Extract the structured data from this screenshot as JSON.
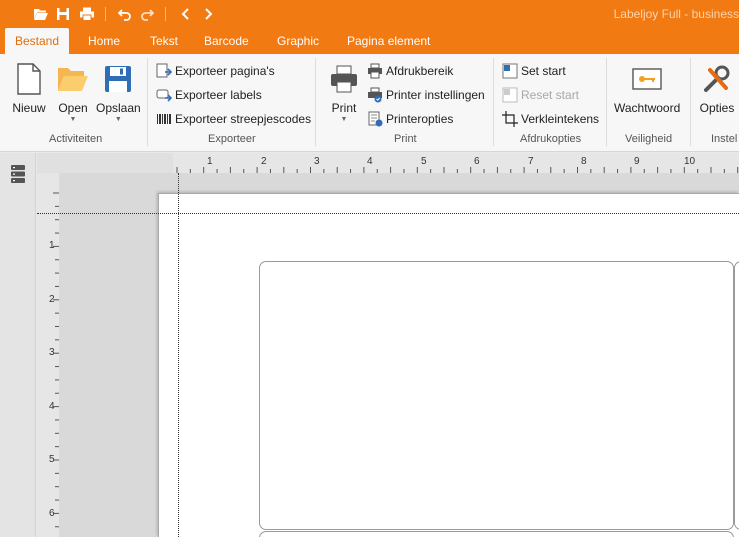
{
  "app": {
    "title": "Labeljoy Full - business",
    "accent": "#f27a12"
  },
  "quick_access": [
    {
      "name": "open-icon"
    },
    {
      "name": "save-icon"
    },
    {
      "name": "print-icon"
    },
    {
      "name": "undo-icon"
    },
    {
      "name": "redo-icon"
    },
    {
      "name": "back-icon"
    },
    {
      "name": "forward-icon"
    }
  ],
  "tabs": [
    {
      "label": "Bestand",
      "active": true
    },
    {
      "label": "Home"
    },
    {
      "label": "Tekst"
    },
    {
      "label": "Barcode"
    },
    {
      "label": "Graphic"
    },
    {
      "label": "Pagina element"
    }
  ],
  "ribbon": {
    "activiteiten": {
      "label": "Activiteiten",
      "nieuw": "Nieuw",
      "open": "Open",
      "opslaan": "Opslaan"
    },
    "exporteer": {
      "label": "Exporteer",
      "paginas": "Exporteer pagina's",
      "labels": "Exporteer labels",
      "streepjescodes": "Exporteer streepjescodes"
    },
    "print": {
      "label": "Print",
      "print": "Print",
      "afdrukbereik": "Afdrukbereik",
      "printer_instellingen": "Printer instellingen",
      "printeropties": "Printeropties"
    },
    "afdrukopties": {
      "label": "Afdrukopties",
      "set_start": "Set start",
      "reset_start": "Reset start",
      "verkleintekens": "Verkleintekens"
    },
    "veiligheid": {
      "label": "Veiligheid",
      "wachtwoord": "Wachtwoord"
    },
    "instellingen": {
      "label": "Instel",
      "opties": "Opties"
    }
  },
  "ruler": {
    "horizontal": [
      "1",
      "2",
      "3",
      "4",
      "5",
      "6",
      "7",
      "8",
      "9",
      "10"
    ],
    "vertical": [
      "1",
      "2",
      "3",
      "4",
      "5",
      "6"
    ]
  }
}
